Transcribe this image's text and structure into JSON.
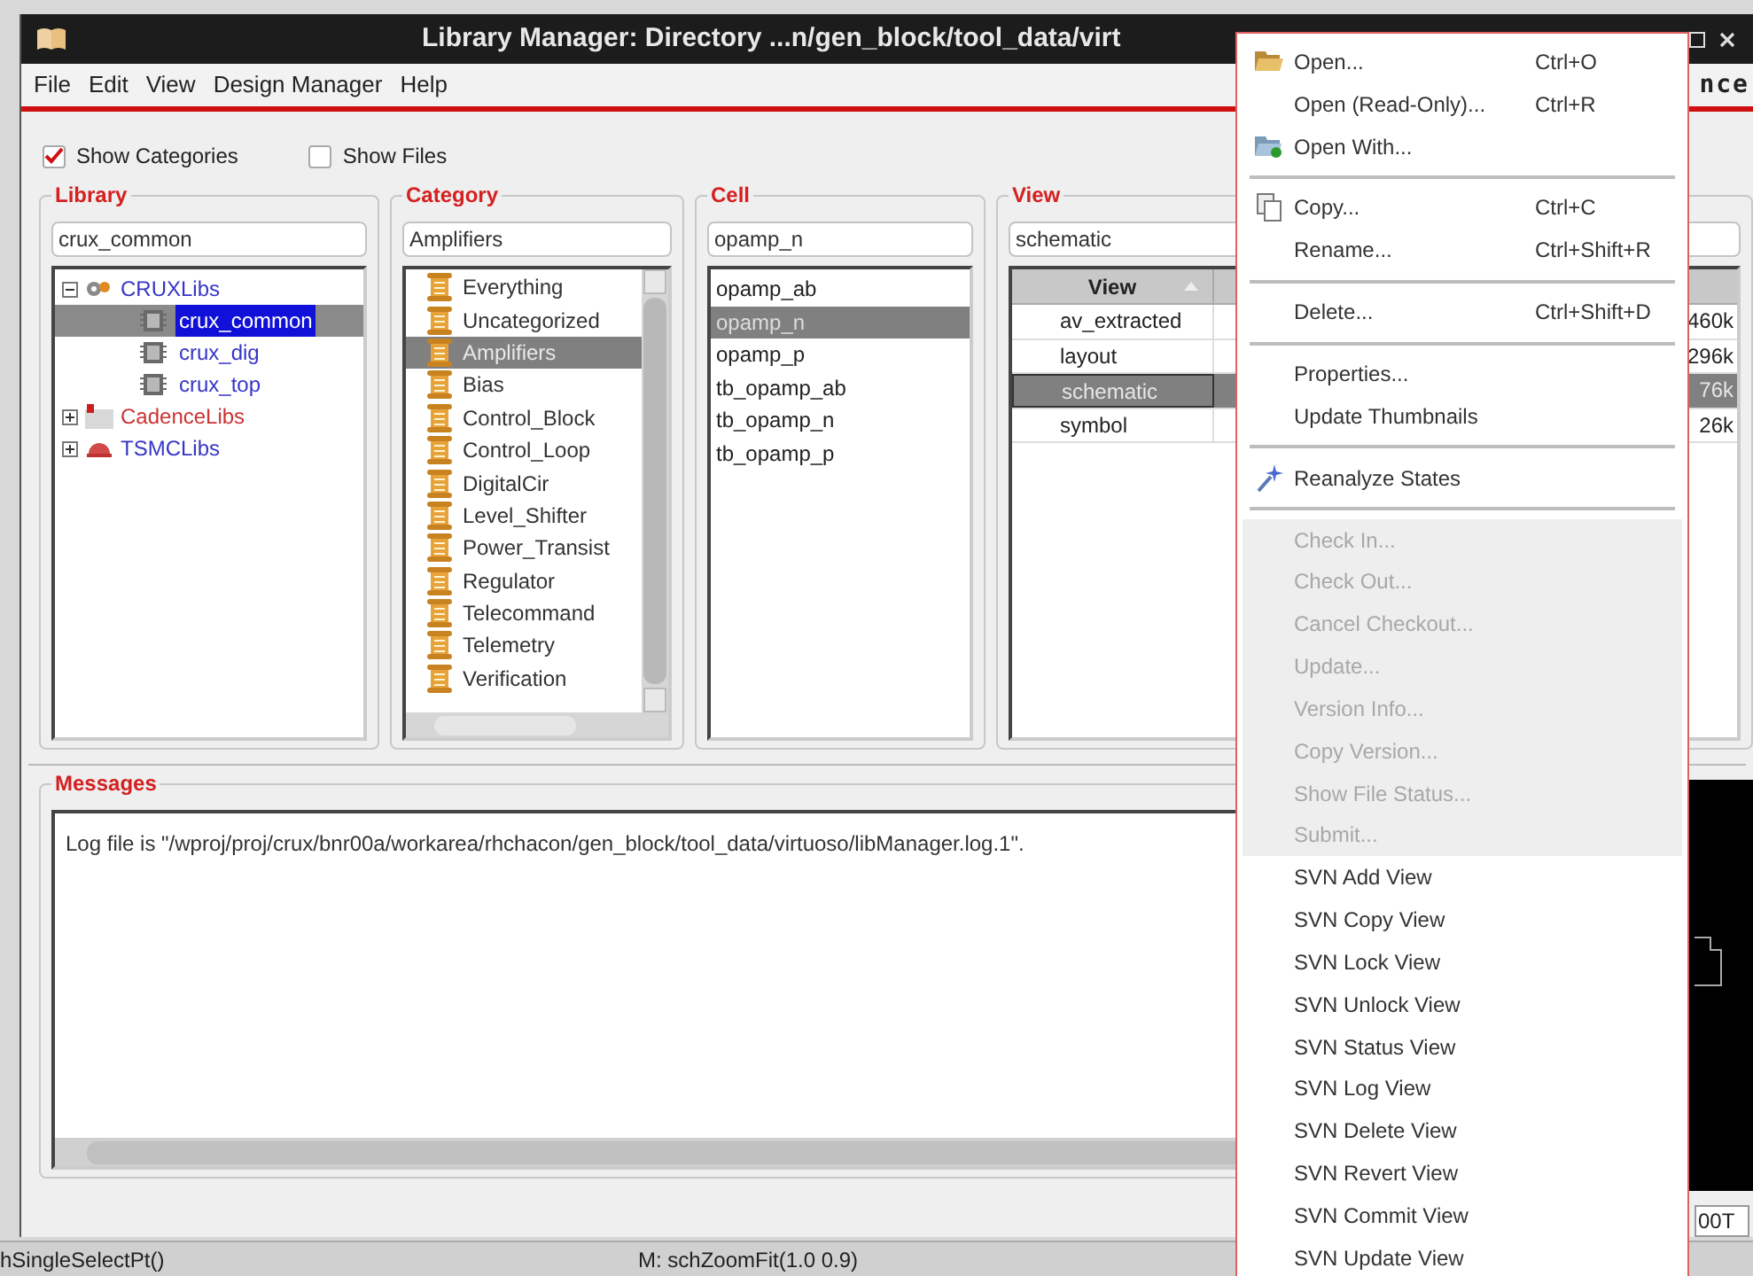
{
  "window": {
    "title": "Library Manager: Directory ...n/gen_block/tool_data/virt",
    "brand_fragment": "nce"
  },
  "menubar": [
    "File",
    "Edit",
    "View",
    "Design Manager",
    "Help"
  ],
  "options": [
    {
      "label": "Show Categories",
      "checked": true
    },
    {
      "label": "Show Files",
      "checked": false
    }
  ],
  "library": {
    "title": "Library",
    "filter": "crux_common",
    "tree": [
      {
        "label": "CRUXLibs",
        "kind": "group",
        "color": "#3535c8",
        "expanded": true,
        "selected": false,
        "children": [
          {
            "label": "crux_common",
            "kind": "library",
            "selected": true
          },
          {
            "label": "crux_dig",
            "kind": "library",
            "color": "#3535c8",
            "selected": false
          },
          {
            "label": "crux_top",
            "kind": "library",
            "color": "#3535c8",
            "selected": false
          }
        ]
      },
      {
        "label": "CadenceLibs",
        "kind": "group",
        "color": "#cc3333",
        "expanded": false,
        "selected": false
      },
      {
        "label": "TSMCLibs",
        "kind": "group",
        "color": "#3535c8",
        "expanded": false,
        "selected": false
      }
    ]
  },
  "category": {
    "title": "Category",
    "filter": "Amplifiers",
    "items": [
      {
        "label": "Everything",
        "selected": false
      },
      {
        "label": "Uncategorized",
        "selected": false
      },
      {
        "label": "Amplifiers",
        "selected": true
      },
      {
        "label": "Bias",
        "selected": false
      },
      {
        "label": "Control_Block",
        "selected": false
      },
      {
        "label": "Control_Loop",
        "selected": false
      },
      {
        "label": "DigitalCir",
        "selected": false
      },
      {
        "label": "Level_Shifter",
        "selected": false
      },
      {
        "label": "Power_Transist",
        "selected": false
      },
      {
        "label": "Regulator",
        "selected": false
      },
      {
        "label": "Telecommand",
        "selected": false
      },
      {
        "label": "Telemetry",
        "selected": false
      },
      {
        "label": "Verification",
        "selected": false
      }
    ]
  },
  "cell": {
    "title": "Cell",
    "filter": "opamp_n",
    "items": [
      {
        "label": "opamp_ab",
        "selected": false
      },
      {
        "label": "opamp_n",
        "selected": true
      },
      {
        "label": "opamp_p",
        "selected": false
      },
      {
        "label": "tb_opamp_ab",
        "selected": false
      },
      {
        "label": "tb_opamp_n",
        "selected": false
      },
      {
        "label": "tb_opamp_p",
        "selected": false
      }
    ]
  },
  "view": {
    "title": "View",
    "filter": "schematic",
    "columns": [
      "View"
    ],
    "rows": [
      {
        "cells": [
          "av_extracted",
          "460k"
        ],
        "selected": false
      },
      {
        "cells": [
          "layout",
          "296k"
        ],
        "selected": false
      },
      {
        "cells": [
          "schematic",
          "76k"
        ],
        "selected": true
      },
      {
        "cells": [
          "symbol",
          "26k"
        ],
        "selected": false
      }
    ]
  },
  "messages": {
    "title": "Messages",
    "lines": [
      "Log file is \"/wproj/proj/crux/bnr00a/workarea/rhchacon/gen_block/tool_data/virtuoso/libManager.log.1\"."
    ]
  },
  "background_window": {
    "field": "00T",
    "status_bar": {
      "left": "hSingleSelectPt()",
      "right": "M: schZoomFit(1.0 0.9)"
    }
  },
  "context_menu": [
    {
      "kind": "item",
      "label": "Open...",
      "shortcut": "Ctrl+O",
      "disabled": false
    },
    {
      "kind": "item",
      "label": "Open (Read-Only)...",
      "shortcut": "Ctrl+R",
      "disabled": false
    },
    {
      "kind": "item",
      "label": "Open With...",
      "disabled": false
    },
    {
      "kind": "separator"
    },
    {
      "kind": "item",
      "label": "Copy...",
      "shortcut": "Ctrl+C",
      "disabled": false
    },
    {
      "kind": "item",
      "label": "Rename...",
      "shortcut": "Ctrl+Shift+R",
      "disabled": false
    },
    {
      "kind": "separator"
    },
    {
      "kind": "item",
      "label": "Delete...",
      "shortcut": "Ctrl+Shift+D",
      "disabled": false
    },
    {
      "kind": "separator"
    },
    {
      "kind": "item",
      "label": "Properties...",
      "disabled": false
    },
    {
      "kind": "item",
      "label": "Update Thumbnails",
      "disabled": false
    },
    {
      "kind": "separator"
    },
    {
      "kind": "item",
      "label": "Reanalyze States",
      "disabled": false
    },
    {
      "kind": "separator"
    },
    {
      "kind": "item",
      "label": "Check In...",
      "disabled": true
    },
    {
      "kind": "item",
      "label": "Check Out...",
      "disabled": true
    },
    {
      "kind": "item",
      "label": "Cancel Checkout...",
      "disabled": true
    },
    {
      "kind": "item",
      "label": "Update...",
      "disabled": true
    },
    {
      "kind": "item",
      "label": "Version Info...",
      "disabled": true
    },
    {
      "kind": "item",
      "label": "Copy Version...",
      "disabled": true
    },
    {
      "kind": "item",
      "label": "Show File Status...",
      "disabled": true
    },
    {
      "kind": "item",
      "label": "Submit...",
      "disabled": true
    },
    {
      "kind": "item",
      "label": "SVN Add View",
      "disabled": false
    },
    {
      "kind": "item",
      "label": "SVN Copy View",
      "disabled": false
    },
    {
      "kind": "item",
      "label": "SVN Lock View",
      "disabled": false
    },
    {
      "kind": "item",
      "label": "SVN Unlock View",
      "disabled": false
    },
    {
      "kind": "item",
      "label": "SVN Status View",
      "disabled": false
    },
    {
      "kind": "item",
      "label": "SVN Log View",
      "disabled": false
    },
    {
      "kind": "item",
      "label": "SVN Delete View",
      "disabled": false
    },
    {
      "kind": "item",
      "label": "SVN Revert View",
      "disabled": false
    },
    {
      "kind": "item",
      "label": "SVN Commit View",
      "disabled": false
    },
    {
      "kind": "item",
      "label": "SVN Update View",
      "disabled": false
    }
  ]
}
